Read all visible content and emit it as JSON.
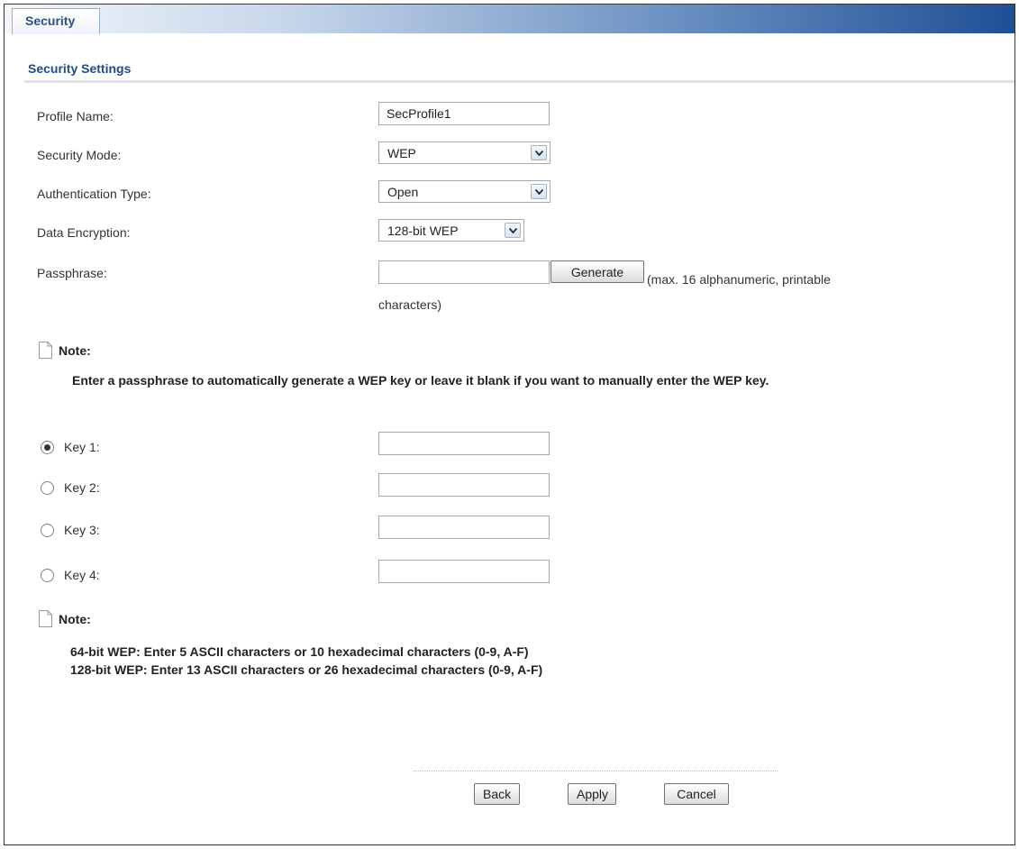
{
  "tab": {
    "label": "Security"
  },
  "section": {
    "title": "Security Settings"
  },
  "fields": {
    "profile_name": {
      "label": "Profile Name:",
      "value": "SecProfile1"
    },
    "security_mode": {
      "label": "Security Mode:",
      "value": "WEP"
    },
    "auth_type": {
      "label": "Authentication Type:",
      "value": "Open"
    },
    "data_encryption": {
      "label": "Data Encryption:",
      "value": "128-bit WEP"
    },
    "passphrase": {
      "label": "Passphrase:",
      "value": "",
      "button": "Generate",
      "hint_line1": "(max. 16 alphanumeric, printable",
      "hint_line2": "characters)"
    }
  },
  "note1": {
    "title": "Note:",
    "text": "Enter a passphrase to automatically generate a WEP key or leave it blank if you want to manually enter the WEP key."
  },
  "keys": [
    {
      "label": "Key 1:",
      "selected": true,
      "value": ""
    },
    {
      "label": "Key 2:",
      "selected": false,
      "value": ""
    },
    {
      "label": "Key 3:",
      "selected": false,
      "value": ""
    },
    {
      "label": "Key 4:",
      "selected": false,
      "value": ""
    }
  ],
  "note2": {
    "title": "Note:",
    "line1": "64-bit WEP: Enter 5 ASCII characters or 10 hexadecimal characters (0-9, A-F)",
    "line2": "128-bit WEP: Enter 13 ASCII characters or 26 hexadecimal characters (0-9, A-F)"
  },
  "buttons": {
    "back": "Back",
    "apply": "Apply",
    "cancel": "Cancel"
  },
  "icons": {
    "dropdown": "chevron-down-icon",
    "note": "note-page-icon"
  },
  "colors": {
    "accent": "#1f4f95",
    "section_title": "#214d86"
  }
}
